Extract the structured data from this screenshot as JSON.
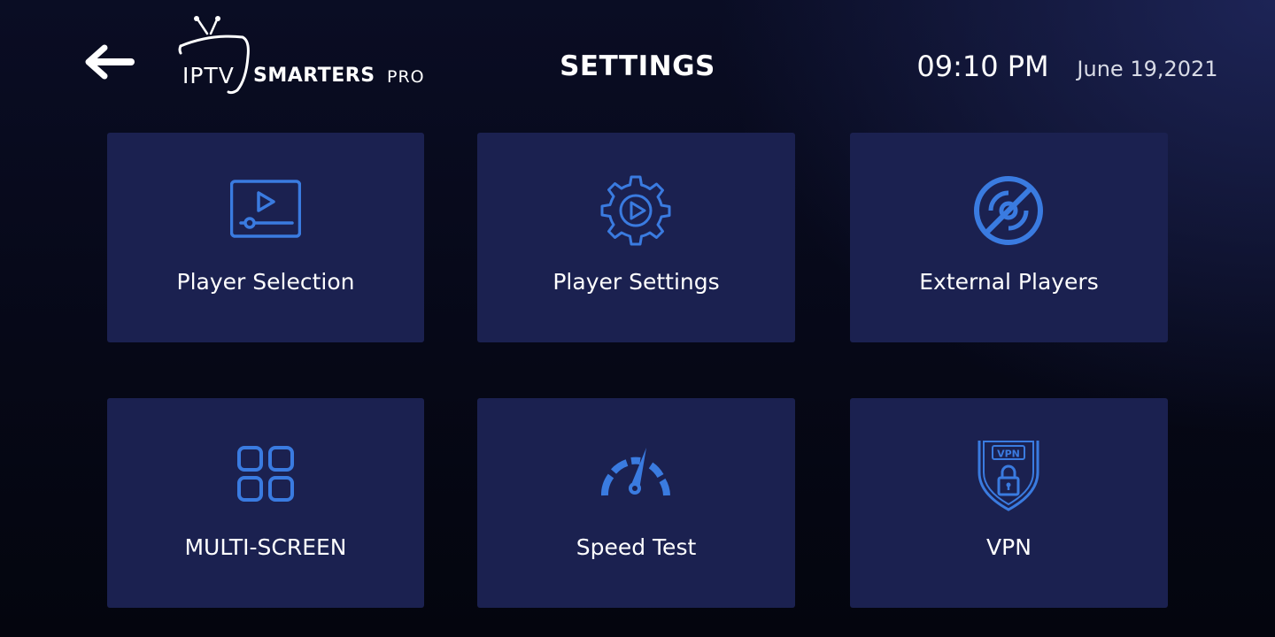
{
  "header": {
    "back_icon": "arrow-left-icon",
    "logo": {
      "iptv": "IPTV",
      "smarters": "SMARTERS",
      "pro": "PRO"
    },
    "title": "SETTINGS",
    "time": "09:10 PM",
    "date": "June 19,2021"
  },
  "tiles": [
    {
      "label": "Player Selection",
      "icon": "video-player-icon"
    },
    {
      "label": "Player Settings",
      "icon": "gear-play-icon"
    },
    {
      "label": "External Players",
      "icon": "disc-off-icon"
    },
    {
      "label": "MULTI-SCREEN",
      "icon": "grid-icon"
    },
    {
      "label": "Speed Test",
      "icon": "speedometer-icon"
    },
    {
      "label": "VPN",
      "icon": "vpn-shield-icon"
    }
  ],
  "colors": {
    "tile_background": "#1b2150",
    "icon_accent": "#3a7be0",
    "page_background": "#070918"
  }
}
